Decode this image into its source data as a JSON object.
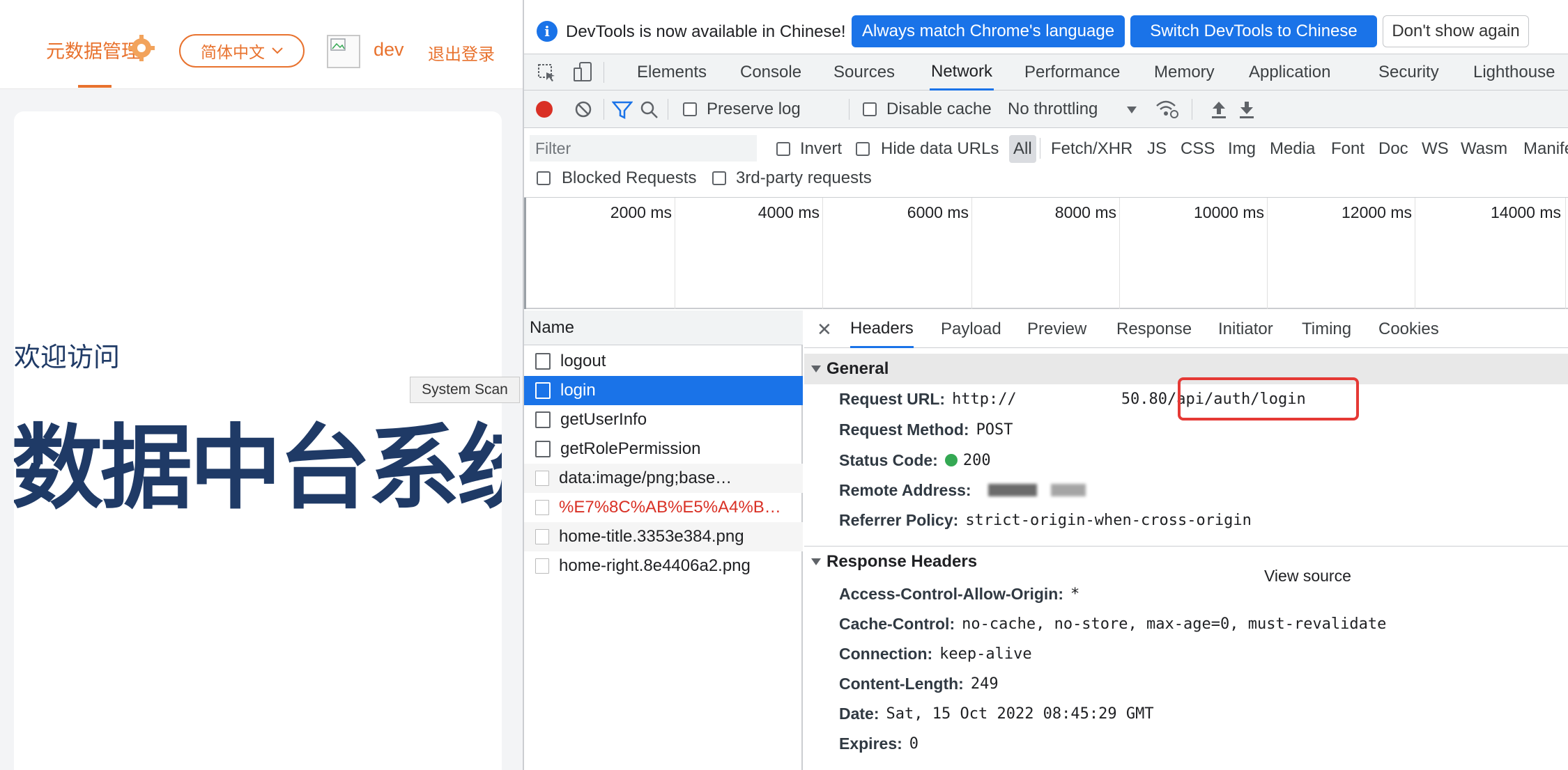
{
  "site": {
    "brand": "元数据管理",
    "language_button": "简体中文",
    "username": "dev",
    "logout": "退出登录",
    "welcome": "欢迎访问",
    "title": "数据中台系统",
    "tooltip": "System Scan"
  },
  "devtools": {
    "infobar": {
      "message": "DevTools is now available in Chinese!",
      "btn_match": "Always match Chrome's language",
      "btn_switch": "Switch DevTools to Chinese",
      "btn_dismiss": "Don't show again"
    },
    "tabs": [
      "Elements",
      "Console",
      "Sources",
      "Network",
      "Performance",
      "Memory",
      "Application",
      "Security",
      "Lighthouse"
    ],
    "active_tab": "Network",
    "toolbar": {
      "preserve_log": "Preserve log",
      "disable_cache": "Disable cache",
      "throttling": "No throttling"
    },
    "filter": {
      "placeholder": "Filter",
      "invert": "Invert",
      "hide_data_urls": "Hide data URLs",
      "types": [
        "All",
        "Fetch/XHR",
        "JS",
        "CSS",
        "Img",
        "Media",
        "Font",
        "Doc",
        "WS",
        "Wasm",
        "Manife"
      ],
      "blocked_requests": "Blocked Requests",
      "third_party": "3rd-party requests"
    },
    "overview_ticks": [
      "2000 ms",
      "4000 ms",
      "6000 ms",
      "8000 ms",
      "10000 ms",
      "12000 ms",
      "14000 ms"
    ],
    "request_list": {
      "header": "Name",
      "rows": [
        {
          "name": "logout"
        },
        {
          "name": "login"
        },
        {
          "name": "getUserInfo"
        },
        {
          "name": "getRolePermission"
        },
        {
          "name": "data:image/png;base…"
        },
        {
          "name": "%E7%8C%AB%E5%A4%B…"
        },
        {
          "name": "home-title.3353e384.png"
        },
        {
          "name": "home-right.8e4406a2.png"
        }
      ]
    },
    "details": {
      "tabs": [
        "Headers",
        "Payload",
        "Preview",
        "Response",
        "Initiator",
        "Timing",
        "Cookies"
      ],
      "active_tab": "Headers",
      "general_title": "General",
      "general": {
        "request_url_label": "Request URL:",
        "request_url_prefix": "http://",
        "request_url_mid": "50.80",
        "request_url_suffix": "/api/auth/login",
        "method_label": "Request Method:",
        "method": "POST",
        "status_label": "Status Code:",
        "status": "200",
        "remote_label": "Remote Address:",
        "referrer_label": "Referrer Policy:",
        "referrer": "strict-origin-when-cross-origin"
      },
      "response_title": "Response Headers",
      "view_source": "View source",
      "response_headers": [
        {
          "key": "Access-Control-Allow-Origin:",
          "value": "*"
        },
        {
          "key": "Cache-Control:",
          "value": "no-cache, no-store, max-age=0, must-revalidate"
        },
        {
          "key": "Connection:",
          "value": "keep-alive"
        },
        {
          "key": "Content-Length:",
          "value": "249"
        },
        {
          "key": "Date:",
          "value": "Sat, 15 Oct 2022 08:45:29 GMT"
        },
        {
          "key": "Expires:",
          "value": "0"
        }
      ]
    }
  },
  "colors": {
    "brand_orange": "#e8722e",
    "title_navy": "#1f3a66",
    "devtools_blue": "#1a73e8",
    "annotation_red": "#e53935",
    "status_green": "#34a853",
    "error_red": "#d93025"
  }
}
